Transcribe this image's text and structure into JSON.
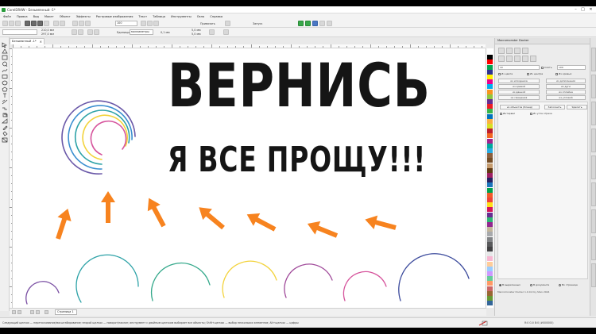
{
  "window": {
    "title": "CorelDRAW - Безымянный -1*",
    "minimize_glyph": "–",
    "maximize_glyph": "□",
    "close_glyph": "✕"
  },
  "menu": [
    "Файл",
    "Правка",
    "Вид",
    "Макет",
    "Объект",
    "Эффекты",
    "Растровые изображения",
    "Текст",
    "Таблица",
    "Инструменты",
    "Окно",
    "Справка"
  ],
  "toolbar": {
    "zoom_value": "100",
    "snap_label": "Привязать",
    "launch_label": "Запуск",
    "w_value": "210,0 мм",
    "h_value": "297,0 мм",
    "units_label": "Единицы:",
    "units_value": "миллиметры",
    "nudge_value": "0,1 мм",
    "dup_x": "5,0 мм",
    "dup_y": "5,0 мм"
  },
  "document": {
    "tab_label": "Безымянный -1*",
    "tab_close": "×",
    "page_tab": "Страница 1"
  },
  "canvas": {
    "headline_1": "ВЕРНИСЬ",
    "headline_2": "Я ВСЕ ПРОЩУ!!!"
  },
  "docker": {
    "title": "Macromonster Docker",
    "field_1": "10",
    "field_2": "100",
    "check_1": "Слить",
    "check_2": "Из цвета",
    "check_3": "Из центра",
    "check_4": "Из кривых",
    "check_5": "Интервал",
    "check_6": "Из угла отреза",
    "btn_1": "из исходника",
    "btn_2": "из дополнения",
    "btn_3": "из кривой",
    "btn_4": "из дуги",
    "btn_5": "из данной",
    "btn_6": "из сплайна",
    "btn_7": "из смещения",
    "btn_8": "из угловой",
    "btn_9": "из объектов (бленд)",
    "btn_10": "Заполнить",
    "btn_11": "Удалить",
    "radio_1": "В выделенных",
    "radio_2": "В документе",
    "radio_3": "Во странице",
    "footer": "Macromonster Docker 1.0.0.0 by Stan 2024"
  },
  "status": {
    "text": "Следующий щелчок — перетаскивание/масштабирование; второй щелчок — поворот/наклон; инструмент с двойным щелчком выбирает все объекты; Shift+щелчок — выбор нескольких элементов; Alt+щелчок — цифры",
    "right_text": "R:0 G:0 B:0 (#000000)"
  },
  "icons": [
    "pick-icon",
    "shape-icon",
    "crop-icon",
    "zoom-icon",
    "freehand-icon",
    "rectangle-icon",
    "ellipse-icon",
    "polygon-icon",
    "text-icon",
    "parallel-icon",
    "connector-icon",
    "shadow-icon",
    "transparency-icon",
    "eyedropper-icon",
    "fill-icon",
    "smart-fill-icon"
  ],
  "colors": {
    "accent": "#f7831f",
    "arc_palette": [
      "#7a4fa3",
      "#d6549c",
      "#f3d33c",
      "#2da2a7",
      "#3b8fd0"
    ]
  }
}
